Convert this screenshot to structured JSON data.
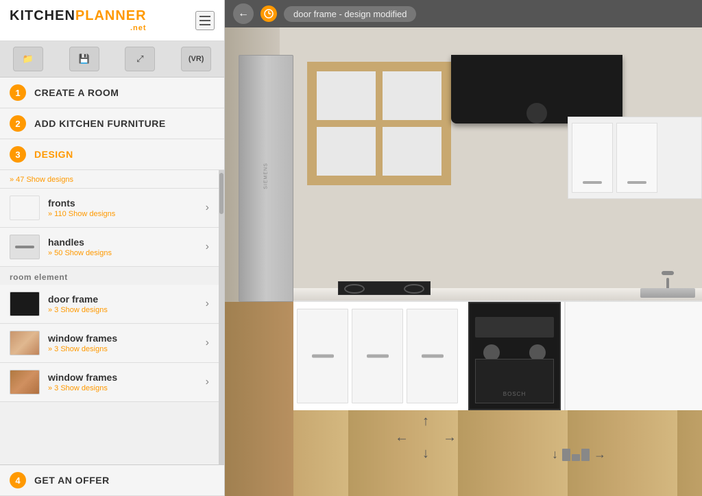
{
  "app": {
    "title_kitchen": "KITCHEN",
    "title_planner": "PLANNER",
    "title_net": ".net"
  },
  "toolbar": {
    "buttons": [
      {
        "id": "folder",
        "icon": "📁"
      },
      {
        "id": "save",
        "icon": "💾"
      },
      {
        "id": "expand",
        "icon": "⤢"
      },
      {
        "id": "vr",
        "label": "VR"
      }
    ]
  },
  "steps": [
    {
      "id": 1,
      "label": "CREATE A ROOM",
      "active": false
    },
    {
      "id": 2,
      "label": "ADD KITCHEN FURNITURE",
      "active": false
    },
    {
      "id": 3,
      "label": "DESIGN",
      "active": true
    },
    {
      "id": 4,
      "label": "GET AN OFFER",
      "active": false
    }
  ],
  "design": {
    "partial_label": "» 47 Show designs",
    "items": [
      {
        "id": "fronts",
        "name": "fronts",
        "sub": "» 110 Show designs",
        "thumb_class": "thumb-white"
      },
      {
        "id": "handles",
        "name": "handles",
        "sub": "» 50 Show designs",
        "thumb_class": "thumb-handle"
      }
    ],
    "room_section": "room element",
    "room_items": [
      {
        "id": "door-frame",
        "name": "door frame",
        "sub": "» 3 Show designs",
        "thumb_class": "thumb-dark"
      },
      {
        "id": "window-frames-1",
        "name": "window frames",
        "sub": "» 3 Show designs",
        "thumb_class": "thumb-wood"
      },
      {
        "id": "window-frames-2",
        "name": "window frames",
        "sub": "» 3 Show designs",
        "thumb_class": "thumb-wood2"
      }
    ]
  },
  "topbar": {
    "breadcrumb": "door frame - design modified"
  },
  "nav": {
    "arrows": [
      "↑",
      "↓",
      "←",
      "→"
    ]
  }
}
